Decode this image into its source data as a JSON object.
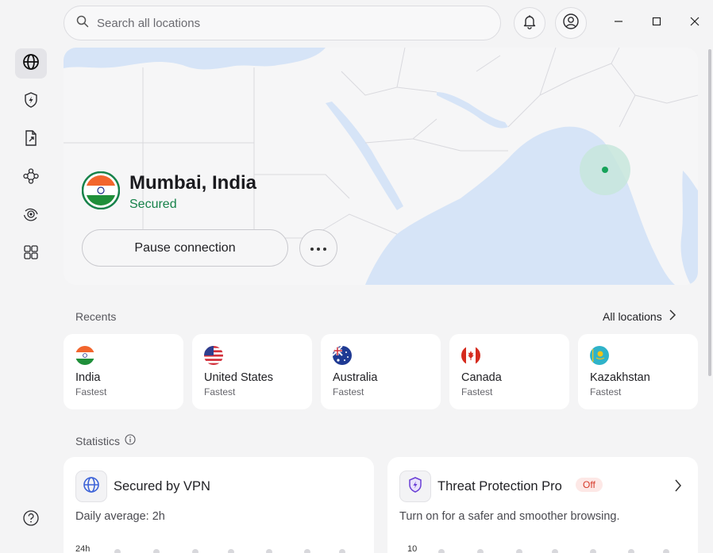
{
  "search": {
    "placeholder": "Search all locations"
  },
  "header_icons": [
    "bell-icon",
    "account-icon"
  ],
  "window_controls": [
    "minimize-icon",
    "maximize-icon",
    "close-icon"
  ],
  "sidebar": {
    "items": [
      {
        "icon": "globe-icon",
        "active": true
      },
      {
        "icon": "shield-bolt-icon",
        "active": false
      },
      {
        "icon": "file-share-icon",
        "active": false
      },
      {
        "icon": "meshnet-icon",
        "active": false
      },
      {
        "icon": "eye-scan-icon",
        "active": false
      },
      {
        "icon": "apps-grid-icon",
        "active": false
      }
    ],
    "bottom_icon": "help-icon"
  },
  "connection": {
    "location": "Mumbai, India",
    "status": "Secured",
    "flag": "india",
    "pause_label": "Pause connection",
    "more_icon": "more-dots-icon"
  },
  "recents": {
    "title": "Recents",
    "all_locations_label": "All locations",
    "items": [
      {
        "country": "India",
        "sub": "Fastest",
        "flag": "india"
      },
      {
        "country": "United States",
        "sub": "Fastest",
        "flag": "united-states"
      },
      {
        "country": "Australia",
        "sub": "Fastest",
        "flag": "australia"
      },
      {
        "country": "Canada",
        "sub": "Fastest",
        "flag": "canada"
      },
      {
        "country": "Kazakhstan",
        "sub": "Fastest",
        "flag": "kazakhstan"
      }
    ]
  },
  "statistics": {
    "title": "Statistics",
    "vpn_card": {
      "title": "Secured by VPN",
      "sub_prefix": "Daily average: ",
      "sub_value": "2h",
      "axis_top": "24h"
    },
    "threat_card": {
      "title": "Threat Protection Pro",
      "badge": "Off",
      "sub": "Turn on for a safer and smoother browsing.",
      "axis_top": "10"
    }
  },
  "colors": {
    "accent_green": "#17824a",
    "map_water": "#d6e4f7",
    "badge_red": "#d63a2a"
  }
}
